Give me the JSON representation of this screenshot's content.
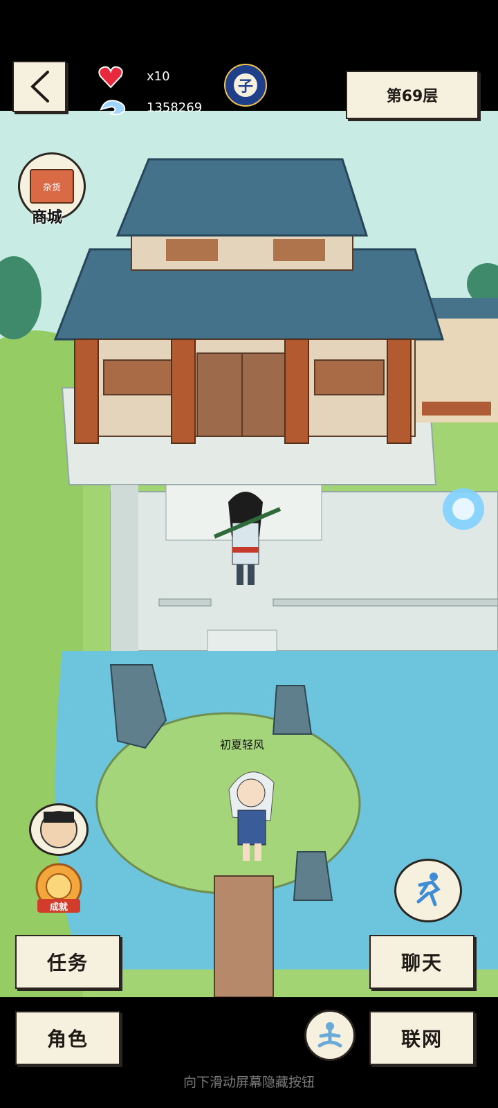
{
  "header": {
    "lives_label": "x10",
    "currency_value": "1358269",
    "time_badge": "子",
    "floor_label": "第69层"
  },
  "scene": {
    "shop_label": "商城",
    "shop_sign": "杂货",
    "npc_name": "初夏轻风",
    "achievement_label": "成就"
  },
  "menu": {
    "tasks": "任务",
    "character": "角色",
    "chat": "聊天",
    "online": "联网"
  },
  "footer": {
    "hint": "向下滑动屏幕隐藏按钮"
  },
  "colors": {
    "paper": "#f6f0df",
    "roof": "#3f6c80",
    "water": "#6cc4dd",
    "grass": "#9bcf6c"
  }
}
